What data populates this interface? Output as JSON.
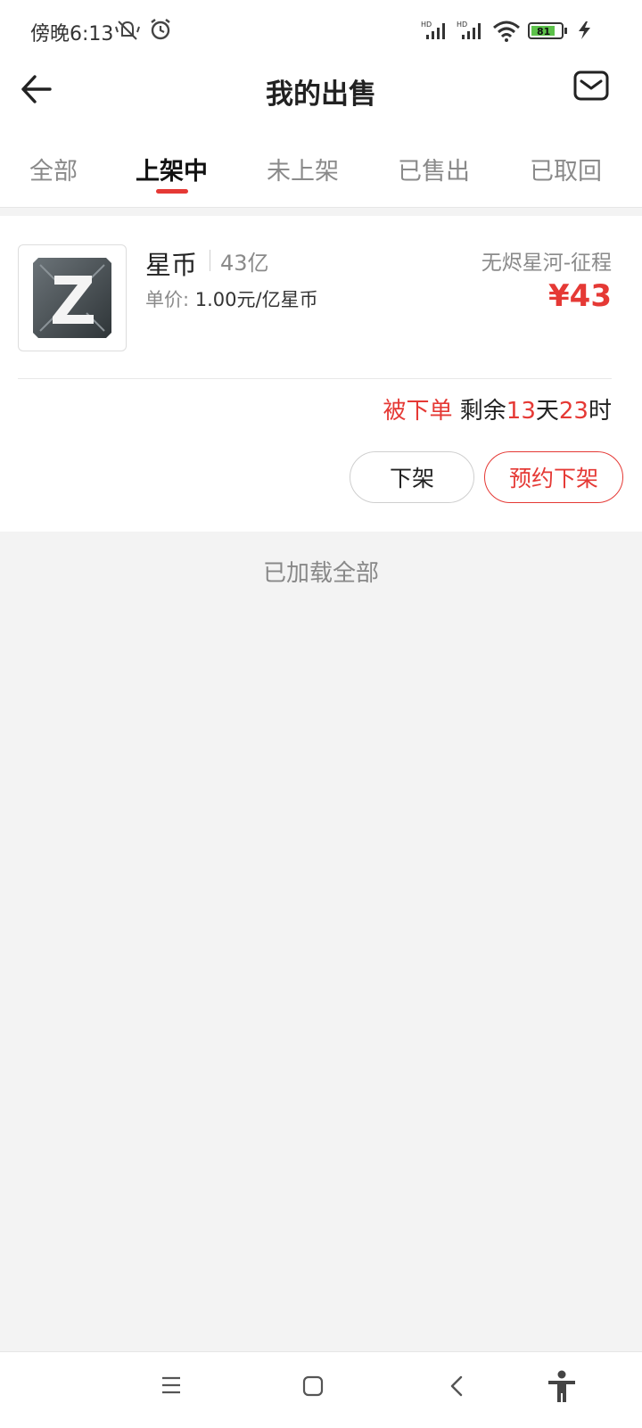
{
  "status_bar": {
    "time": "傍晚6:13",
    "battery": "81",
    "icons": [
      "mute-icon",
      "alarm-icon",
      "signal-hd-icon",
      "signal-hd-icon",
      "wifi-icon",
      "battery-icon",
      "charging-icon"
    ]
  },
  "header": {
    "title": "我的出售",
    "back_icon": "arrow-left-icon",
    "mail_icon": "mail-icon"
  },
  "tabs": [
    {
      "label": "全部",
      "active": false
    },
    {
      "label": "上架中",
      "active": true
    },
    {
      "label": "未上架",
      "active": false
    },
    {
      "label": "已售出",
      "active": false
    },
    {
      "label": "已取回",
      "active": false
    }
  ],
  "listing": {
    "name": "星币",
    "quantity": "43亿",
    "unit_price_label": "单价:",
    "unit_price_value": "1.00元/亿星币",
    "server": "无烬星河-征程",
    "price": "¥43",
    "status_prefix": "被下单",
    "remain_label": "剩余",
    "days": "13",
    "days_unit": "天",
    "hours": "23",
    "hours_unit": "时",
    "btn_off": "下架",
    "btn_schedule": "预约下架"
  },
  "footer_text": "已加载全部",
  "nav_bar": {
    "icons": [
      "menu-icon",
      "home-icon",
      "back-icon",
      "accessibility-icon"
    ]
  },
  "colors": {
    "accent": "#e53935",
    "background": "#f3f3f3"
  }
}
